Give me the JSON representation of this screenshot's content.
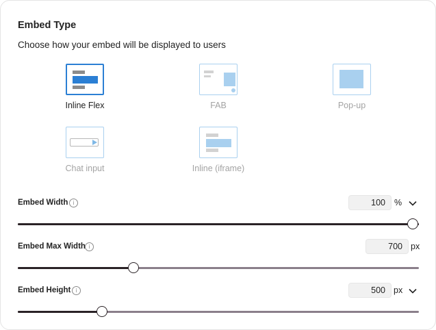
{
  "embed_type": {
    "title": "Embed Type",
    "subtitle": "Choose how your embed will be displayed to users",
    "options": [
      {
        "label": "Inline Flex",
        "selected": true
      },
      {
        "label": "FAB",
        "selected": false
      },
      {
        "label": "Pop-up",
        "selected": false
      },
      {
        "label": "Chat input",
        "selected": false
      },
      {
        "label": "Inline (iframe)",
        "selected": false
      }
    ]
  },
  "settings": {
    "width": {
      "label": "Embed Width",
      "value": "100",
      "unit": "%",
      "slider_fraction": 1.0
    },
    "max_width": {
      "label": "Embed Max Width",
      "value": "700",
      "unit": "px",
      "slider_fraction": 0.29
    },
    "height": {
      "label": "Embed Height",
      "value": "500",
      "unit": "px",
      "slider_fraction": 0.21
    }
  },
  "colors": {
    "accent": "#2b7fd4",
    "accent_light": "#a9d0ef",
    "slider_dark": "#2a2226",
    "slider_track": "#8a7f8a"
  },
  "icons": [
    "info-icon",
    "chevron-down-icon"
  ]
}
